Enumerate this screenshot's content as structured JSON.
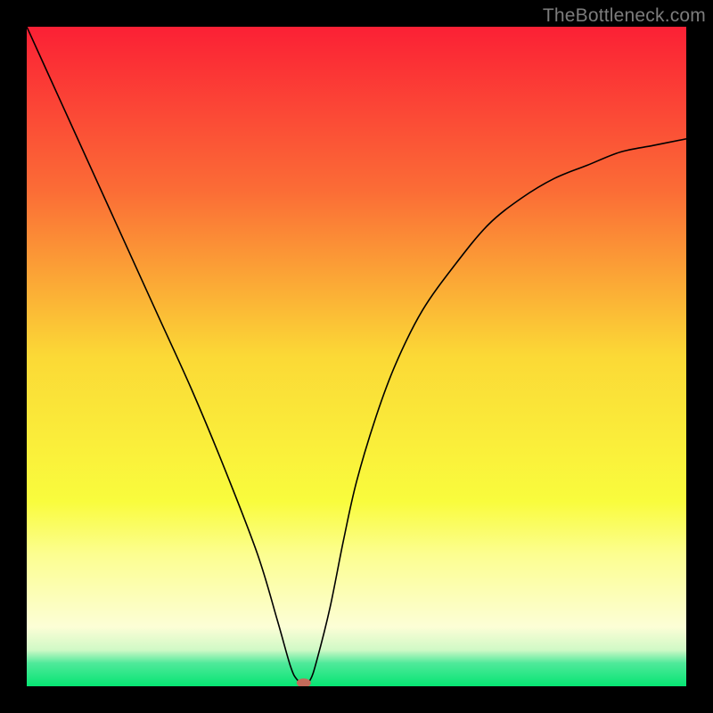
{
  "watermark": "TheBottleneck.com",
  "chart_data": {
    "type": "line",
    "title": "",
    "xlabel": "",
    "ylabel": "",
    "xlim": [
      0,
      100
    ],
    "ylim": [
      0,
      100
    ],
    "grid": false,
    "background_gradient": {
      "stops": [
        {
          "offset": 0.0,
          "color": "#fb2035"
        },
        {
          "offset": 0.25,
          "color": "#fb6d36"
        },
        {
          "offset": 0.5,
          "color": "#fbd936"
        },
        {
          "offset": 0.72,
          "color": "#f9fc3d"
        },
        {
          "offset": 0.8,
          "color": "#fcfe90"
        },
        {
          "offset": 0.91,
          "color": "#fcfed6"
        },
        {
          "offset": 0.945,
          "color": "#d0f9c6"
        },
        {
          "offset": 0.965,
          "color": "#4fe99a"
        },
        {
          "offset": 1.0,
          "color": "#06e573"
        }
      ]
    },
    "series": [
      {
        "name": "bottleneck-curve",
        "color": "#000000",
        "width": 1.6,
        "x": [
          0,
          5,
          10,
          15,
          20,
          25,
          30,
          35,
          38,
          40,
          41,
          42,
          43,
          44,
          46,
          48,
          50,
          53,
          56,
          60,
          65,
          70,
          75,
          80,
          85,
          90,
          95,
          100
        ],
        "values": [
          100,
          89,
          78,
          67,
          56,
          45,
          33,
          20,
          10,
          3,
          1,
          0.5,
          1,
          4,
          12,
          22,
          31,
          41,
          49,
          57,
          64,
          70,
          74,
          77,
          79,
          81,
          82,
          83
        ]
      }
    ],
    "marker": {
      "name": "bottleneck-point",
      "x": 42,
      "y": 0.5,
      "color": "#c46a5a",
      "rx": 8,
      "ry": 5
    }
  }
}
